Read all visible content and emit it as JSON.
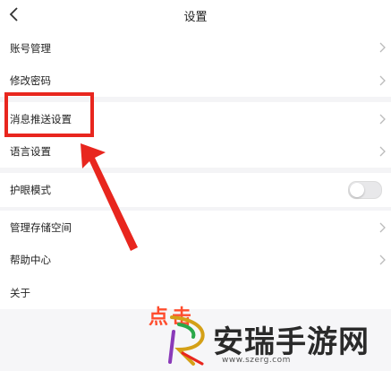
{
  "header": {
    "title": "设置"
  },
  "menu": {
    "account": "账号管理",
    "password": "修改密码",
    "push": "消息推送设置",
    "language": "语言设置",
    "eye_mode": "护眼模式",
    "storage": "管理存储空间",
    "help": "帮助中心",
    "about": "关于"
  },
  "toggles": {
    "eye_mode_on": false
  },
  "annotation": {
    "click_text": "点击"
  },
  "watermark": {
    "name": "安瑞手游网",
    "url": "www.szerg.com"
  },
  "colors": {
    "highlight": "#e8261e",
    "annotation_text": "#ff4d2e"
  },
  "icons": {
    "back": "chevron-left-icon",
    "row": "chevron-right-icon"
  }
}
